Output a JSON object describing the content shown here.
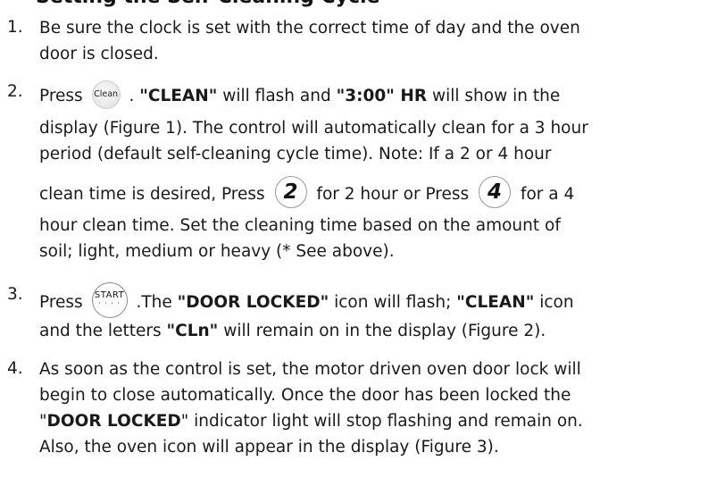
{
  "heading": "Setting the Self-Cleaning Cycle",
  "steps": [
    {
      "number": "1.",
      "lines": [
        "Be sure the clock is set with the correct time of day and the oven",
        "door is closed."
      ]
    },
    {
      "number": "2.",
      "press": "Press",
      "clean_icon_label": "Clean",
      "l1_mid": ".",
      "clean_word": "\"CLEAN\"",
      "l1_mid2": "will flash and",
      "time_word": "\"3:00\" HR",
      "l1_end": "will show in the",
      "l2": "display (Figure 1). The control will automatically clean for a 3 hour",
      "l3": "period (default self-cleaning cycle time). Note: If a 2 or 4 hour",
      "l4_a": "clean time is desired, Press",
      "key_2": "2",
      "l4_b": "for 2 hour or Press",
      "key_4": "4",
      "l4_c": "for a 4",
      "l5": "hour clean time.  Set the cleaning time based on the amount of",
      "l6": "soil; light, medium or heavy (* See above)."
    },
    {
      "number": "3.",
      "press": "Press",
      "start_label": "START",
      "start_dots": "· · · ·",
      "l1_a": ".The",
      "door_word": "\"DOOR LOCKED\"",
      "l1_b": "icon will flash;",
      "clean_word": "\"CLEAN\"",
      "l1_c": "icon",
      "l2_a": "and the letters",
      "cln_word": "\"CLn\"",
      "l2_b": "will remain on in the display (Figure 2)."
    },
    {
      "number": "4.",
      "l1": "As soon as the control is set, the motor driven oven door lock will",
      "l2": "begin to close automatically. Once the door has been locked the",
      "l3_a": "\"",
      "door_word": "DOOR LOCKED",
      "l3_b": "\" indicator light will stop flashing and remain on.",
      "l4": "Also, the oven icon will appear in the display (Figure 3)."
    }
  ]
}
